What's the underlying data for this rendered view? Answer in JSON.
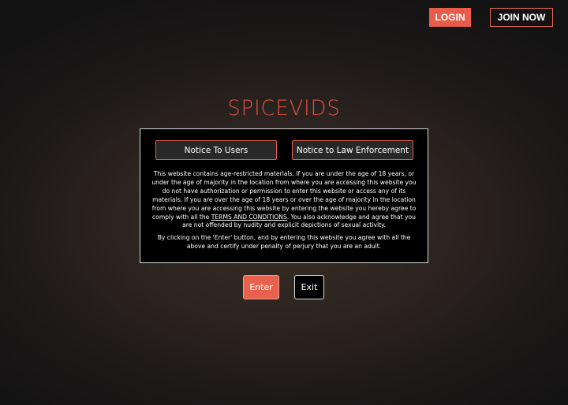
{
  "header": {
    "login_label": "LOGIN",
    "join_label": "JOIN NOW"
  },
  "brand": {
    "logo_text": "SPICEVIDS"
  },
  "notice": {
    "tabs": [
      {
        "label": "Notice To Users"
      },
      {
        "label": "Notice to Law Enforcement"
      }
    ],
    "paragraph1_before_link": "This website contains age-restricted materials. If you are under the age of 18 years, or under the age of majority in the location from where you are accessing this website you do not have authorization or permission to enter this website or access any of its materials. If you are over the age of 18 years or over the age of majority in the location from where you are accessing this website by entering the website you hereby agree to comply with all the ",
    "terms_link_text": "TERMS AND CONDITIONS",
    "paragraph1_after_link": ". You also acknowledge and agree that you are not offended by nudity and explicit depictions of sexual activity.",
    "paragraph2": "By clicking on the 'Enter' button, and by entering this website you agree with all the above and certify under penalty of perjury that you are an adult."
  },
  "actions": {
    "enter_label": "Enter",
    "exit_label": "Exit"
  },
  "colors": {
    "accent": "#e85c4a",
    "background": "#2a2320",
    "panel": "#000000"
  }
}
